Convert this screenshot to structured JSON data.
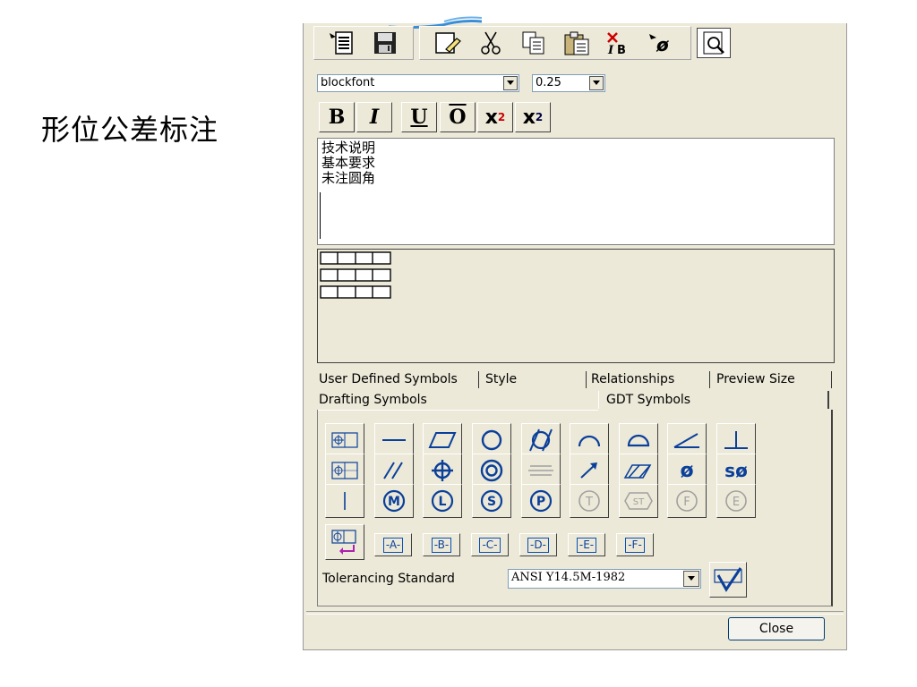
{
  "heading": "形位公差标注",
  "toolbar": {
    "icons": [
      "insert-text-icon",
      "save-icon",
      "edit-icon",
      "cut-icon",
      "copy-icon",
      "paste-icon",
      "delete-format-icon",
      "insert-symbol-icon",
      "preview-icon"
    ]
  },
  "font": {
    "selected": "blockfont"
  },
  "size": {
    "selected": "0.25"
  },
  "format_buttons": [
    {
      "label": "B",
      "name": "bold-button"
    },
    {
      "label": "I",
      "name": "italic-button"
    },
    {
      "label": "U",
      "name": "underline-button"
    },
    {
      "label": "O",
      "name": "overline-button"
    },
    {
      "label": "x",
      "sup": "2",
      "name": "superscript-button"
    },
    {
      "label": "x",
      "sub": "2",
      "name": "subscript-button"
    }
  ],
  "text_lines": [
    "技术说明",
    "基本要求",
    "未注圆角"
  ],
  "tabs": {
    "row1": [
      "User Defined Symbols",
      "Style",
      "Relationships",
      "Preview Size"
    ],
    "row2": [
      "Drafting Symbols",
      "GDT Symbols"
    ]
  },
  "datum_buttons": [
    "-A-",
    "-B-",
    "-C-",
    "-D-",
    "-E-",
    "-F-"
  ],
  "symbol_text": {
    "dia": "ø",
    "sdia": "sø",
    "M": "M",
    "L": "L",
    "S": "S",
    "P": "P",
    "T": "T",
    "ST": "ST",
    "F": "F",
    "E": "E"
  },
  "tolerancing": {
    "label": "Tolerancing Standard",
    "selected": "ANSI Y14.5M-1982"
  },
  "close_label": "Close",
  "colors": {
    "panel": "#ece9d8",
    "symbol_blue": "#0a3f9a",
    "disabled": "#a0a0a0"
  }
}
